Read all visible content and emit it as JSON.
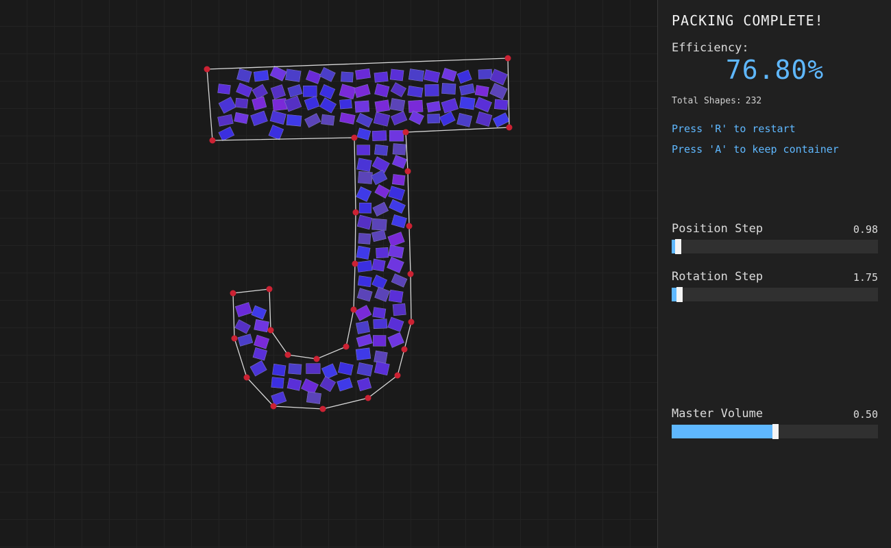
{
  "status": {
    "title": "PACKING COMPLETE!"
  },
  "efficiency": {
    "label": "Efficiency:",
    "value": "76.80%"
  },
  "total_shapes": {
    "label": "Total Shapes:",
    "value": "232",
    "count": 232
  },
  "hints": {
    "restart": "Press 'R' to restart",
    "keep": "Press 'A' to keep container"
  },
  "sliders": {
    "position": {
      "label": "Position Step",
      "value": "0.98",
      "fraction": 0.03
    },
    "rotation": {
      "label": "Rotation Step",
      "value": "1.75",
      "fraction": 0.035
    },
    "volume": {
      "label": "Master Volume",
      "value": "0.50",
      "fraction": 0.5
    }
  },
  "colors": {
    "accent": "#5fb8ff",
    "vertex": "#cc2233",
    "outline": "#d8d8d8",
    "shape_fill_a": "#3b2fe0",
    "shape_fill_b": "#7a2ad8"
  }
}
